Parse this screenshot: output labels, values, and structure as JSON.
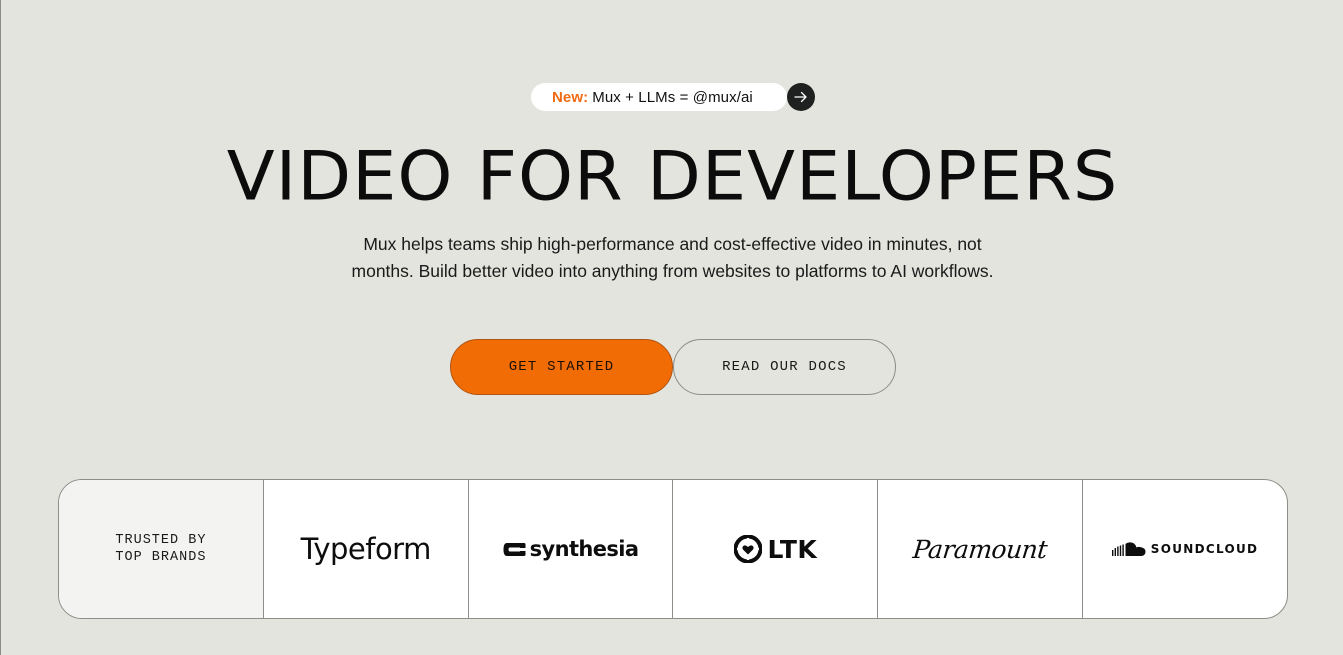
{
  "announcement": {
    "new_label": "New:",
    "text": "Mux + LLMs = @mux/ai",
    "arrow_icon": "arrow-right-icon"
  },
  "hero": {
    "title": "VIDEO FOR DEVELOPERS",
    "subtitle_line1": "Mux helps teams ship high-performance and cost-effective video in minutes, not",
    "subtitle_line2": "months. Build better video into anything from websites to platforms to AI workflows."
  },
  "cta": {
    "primary_label": "GET STARTED",
    "secondary_label": "READ OUR DOCS"
  },
  "brands": {
    "trusted_line1": "TRUSTED BY",
    "trusted_line2": "TOP BRANDS",
    "logos": [
      {
        "name": "Typeform",
        "icon": "typeform-logo"
      },
      {
        "name": "synthesia",
        "icon": "synthesia-logo"
      },
      {
        "name": "LTK",
        "icon": "ltk-logo"
      },
      {
        "name": "Paramount",
        "icon": "paramount-logo"
      },
      {
        "name": "SOUNDCLOUD",
        "icon": "soundcloud-logo"
      }
    ]
  },
  "colors": {
    "background": "#e2e4dd",
    "accent": "#f26c05",
    "new_label": "#f06b12"
  }
}
